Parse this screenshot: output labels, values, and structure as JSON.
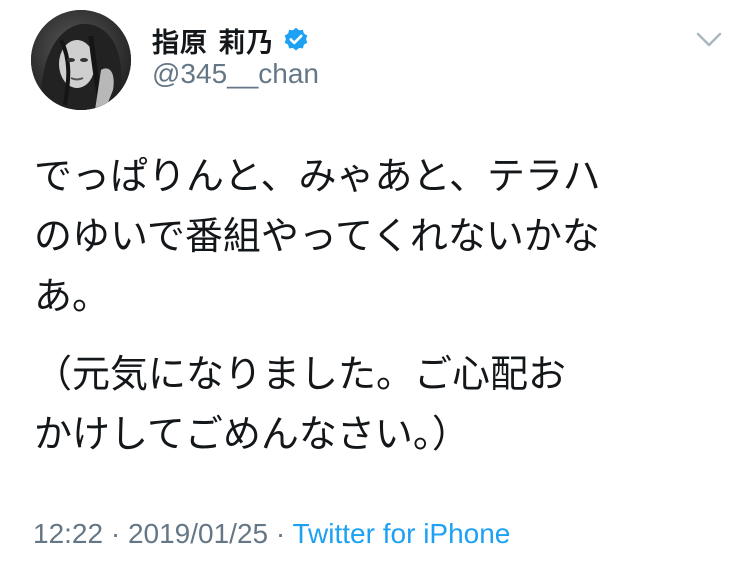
{
  "user": {
    "display_name": "指原 莉乃",
    "handle": "@345__chan",
    "verified": true,
    "verified_color": "#1da1f2"
  },
  "tweet": {
    "paragraph_1": "でっぱりんと、みゃあと、テラハ\nのゆいで番組やってくれないかな\nあ。",
    "paragraph_2": "（元気になりました。ご心配お\nかけしてごめんなさい。）"
  },
  "meta": {
    "time": "12:22",
    "separator": " · ",
    "date": "2019/01/25",
    "source": "Twitter for iPhone",
    "source_color": "#1da1f2"
  },
  "icons": {
    "avatar": "profile-photo",
    "verified": "verified-badge-icon",
    "caret": "chevron-down-icon"
  }
}
